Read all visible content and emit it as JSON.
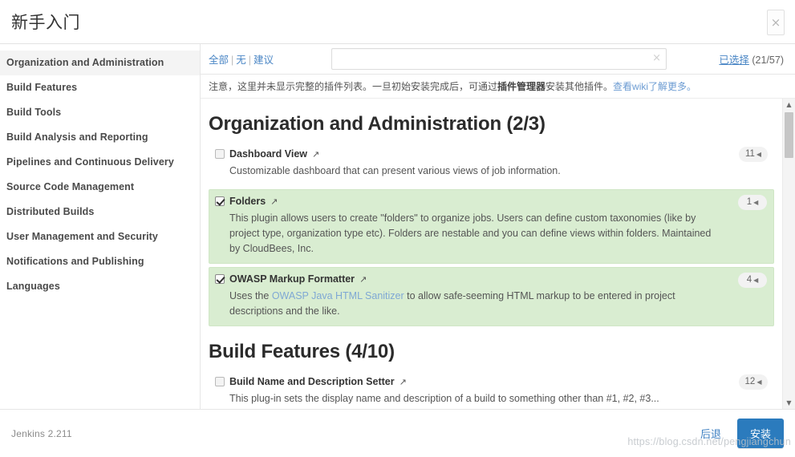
{
  "header": {
    "title": "新手入门",
    "close_label": "×"
  },
  "sidebar": {
    "items": [
      {
        "label": "Organization and Administration",
        "active": true
      },
      {
        "label": "Build Features",
        "active": false
      },
      {
        "label": "Build Tools",
        "active": false
      },
      {
        "label": "Build Analysis and Reporting",
        "active": false
      },
      {
        "label": "Pipelines and Continuous Delivery",
        "active": false
      },
      {
        "label": "Source Code Management",
        "active": false
      },
      {
        "label": "Distributed Builds",
        "active": false
      },
      {
        "label": "User Management and Security",
        "active": false
      },
      {
        "label": "Notifications and Publishing",
        "active": false
      },
      {
        "label": "Languages",
        "active": false
      }
    ]
  },
  "filter_bar": {
    "all_label": "全部",
    "none_label": "无",
    "suggested_label": "建议",
    "separator": "|",
    "search_value": "",
    "search_placeholder": "",
    "clear_label": "×",
    "selected_link": "已选择",
    "selected_count": "(21/57)"
  },
  "notice": {
    "text_before": "注意，这里并未显示完整的插件列表。一旦初始安装完成后，可通过",
    "bold_text": "插件管理器",
    "text_after": "安装其他插件。",
    "link_text": "查看wiki了解更多。"
  },
  "categories": [
    {
      "title": "Organization and Administration (2/3)",
      "plugins": [
        {
          "name": "Dashboard View",
          "checked": false,
          "badge": "11",
          "badge_arrow": "◀",
          "ext_icon": "↗",
          "desc": "Customizable dashboard that can present various views of job information.",
          "desc_link": "",
          "desc_link_pre": "",
          "desc_link_post": ""
        },
        {
          "name": "Folders",
          "checked": true,
          "badge": "1",
          "badge_arrow": "◀",
          "ext_icon": "↗",
          "desc": "This plugin allows users to create \"folders\" to organize jobs. Users can define custom taxonomies (like by project type, organization type etc). Folders are nestable and you can define views within folders. Maintained by CloudBees, Inc.",
          "desc_link": "",
          "desc_link_pre": "",
          "desc_link_post": ""
        },
        {
          "name": "OWASP Markup Formatter",
          "checked": true,
          "badge": "4",
          "badge_arrow": "◀",
          "ext_icon": "↗",
          "desc": "",
          "desc_link_pre": "Uses the ",
          "desc_link": "OWASP Java HTML Sanitizer",
          "desc_link_post": " to allow safe-seeming HTML markup to be entered in project descriptions and the like."
        }
      ]
    },
    {
      "title": "Build Features (4/10)",
      "plugins": [
        {
          "name": "Build Name and Description Setter",
          "checked": false,
          "badge": "12",
          "badge_arrow": "◀",
          "ext_icon": "↗",
          "desc": "This plug-in sets the display name and description of a build to something other than #1, #2, #3...",
          "desc_link": "",
          "desc_link_pre": "",
          "desc_link_post": ""
        }
      ]
    }
  ],
  "scrollbar": {
    "up_arrow": "▲",
    "down_arrow": "▼"
  },
  "footer": {
    "version": "Jenkins 2.211",
    "back_label": "后退",
    "install_label": "安装",
    "watermark": "https://blog.csdn.net/pengjiangchun"
  }
}
